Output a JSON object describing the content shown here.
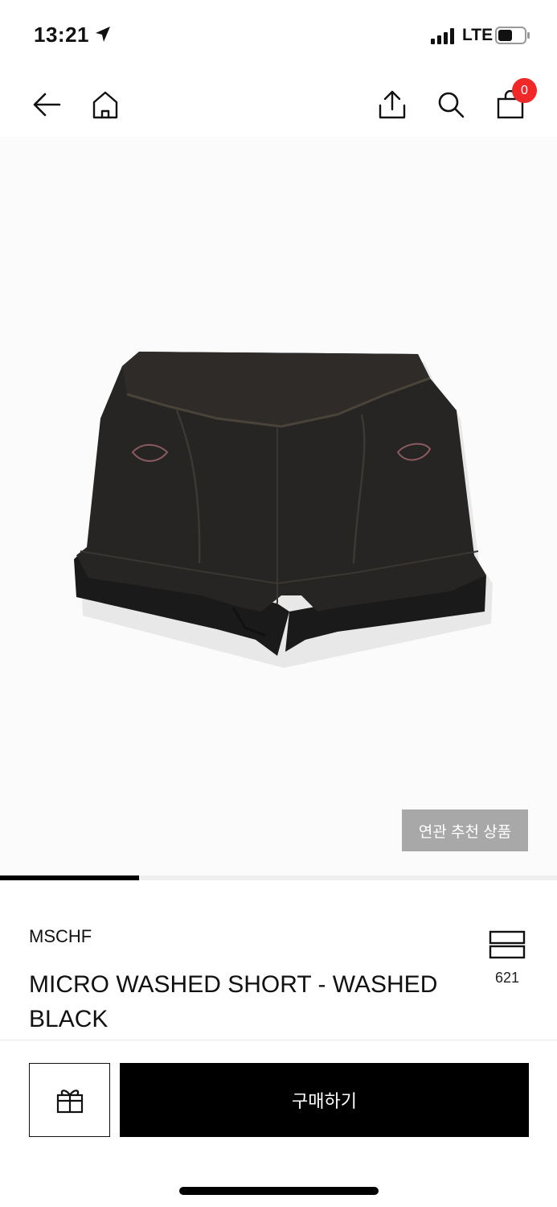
{
  "status_bar": {
    "time": "13:21",
    "network": "LTE",
    "icons": [
      "location-arrow-icon",
      "cellular-signal-icon",
      "battery-icon"
    ]
  },
  "nav": {
    "icons": [
      "back-arrow-icon",
      "home-icon",
      "share-icon",
      "search-icon",
      "shopping-bag-icon"
    ],
    "cart_count": "0",
    "badge_color": "#f02828"
  },
  "gallery": {
    "related_button_label": "연관 추천 상품",
    "image_subject": "black washed shorts"
  },
  "product": {
    "brand": "MSCHF",
    "title": "MICRO WASHED SHORT - WASHED BLACK",
    "like_count": "621"
  },
  "actions": {
    "buy_label": "구매하기",
    "gift_icon": "gift-icon"
  }
}
